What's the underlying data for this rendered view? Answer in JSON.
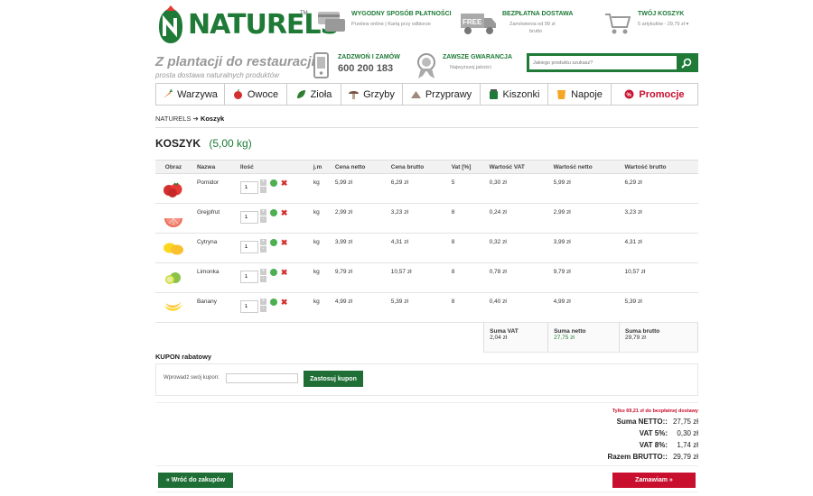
{
  "header": {
    "logo_text": "NATURELS",
    "logo_tm": "TM",
    "payment_title": "WYGODNY SPOSÓB PŁATNOŚCI",
    "payment_sub": "Przelew online | Kartą przy odbiorze",
    "free_badge": "FREE",
    "delivery_title": "BEZPŁATNA DOSTAWA",
    "delivery_sub1": "Zamówienia od 99 zł",
    "delivery_sub2": "brutto",
    "cart_title": "TWÓJ KOSZYK",
    "cart_sub": "5 artykułów - 29,79 zł ▾",
    "tagline": "Z plantacji do restauracji",
    "tagline_sub": "prosta dostawa naturalnych produktów",
    "phone_title": "ZADZWOŃ I ZAMÓW",
    "phone_number": "600 200 183",
    "guarantee_title": "ZAWSZE GWARANCJA",
    "guarantee_sub": "Najwyższej jakości",
    "search_placeholder": "Jakiego produktu szukasz?"
  },
  "nav": [
    {
      "label": "Warzywa",
      "icon": "carrot-icon",
      "color": "#e07b1f"
    },
    {
      "label": "Owoce",
      "icon": "apple-icon",
      "color": "#d32f2f"
    },
    {
      "label": "Zioła",
      "icon": "leaf-icon",
      "color": "#2e7d32"
    },
    {
      "label": "Grzyby",
      "icon": "mushroom-icon",
      "color": "#795548"
    },
    {
      "label": "Przyprawy",
      "icon": "spice-pile-icon",
      "color": "#a1887f"
    },
    {
      "label": "Kiszonki",
      "icon": "jar-icon",
      "color": "#1e7a36"
    },
    {
      "label": "Napoje",
      "icon": "drink-icon",
      "color": "#f5a623"
    },
    {
      "label": "Promocje",
      "icon": "promo-tag-icon",
      "color": "#c8102e"
    }
  ],
  "breadcrumb": {
    "home": "NATURELS",
    "sep": "➔",
    "current": "Koszyk"
  },
  "page": {
    "title": "KOSZYK",
    "weight": "(5,00 kg)"
  },
  "table": {
    "headers": [
      "Obraz",
      "Nazwa",
      "Ilość",
      "j.m",
      "Cena netto",
      "Cena brutto",
      "Vat [%]",
      "Wartość VAT",
      "Wartość netto",
      "Wartość brutto"
    ],
    "rows": [
      {
        "name": "Pomidor",
        "qty": "1",
        "unit": "kg",
        "net": "5,99 zł",
        "gross": "6,29 zł",
        "vat": "5",
        "vat_value": "0,30 zł",
        "net_value": "5,99 zł",
        "gross_value": "6,29 zł",
        "icon": "tomato-icon"
      },
      {
        "name": "Grejpfrut",
        "qty": "1",
        "unit": "kg",
        "net": "2,99 zł",
        "gross": "3,23 zł",
        "vat": "8",
        "vat_value": "0,24 zł",
        "net_value": "2,99 zł",
        "gross_value": "3,23 zł",
        "icon": "grapefruit-icon"
      },
      {
        "name": "Cytryna",
        "qty": "1",
        "unit": "kg",
        "net": "3,99 zł",
        "gross": "4,31 zł",
        "vat": "8",
        "vat_value": "0,32 zł",
        "net_value": "3,99 zł",
        "gross_value": "4,31 zł",
        "icon": "lemon-icon"
      },
      {
        "name": "Limonka",
        "qty": "1",
        "unit": "kg",
        "net": "9,79 zł",
        "gross": "10,57 zł",
        "vat": "8",
        "vat_value": "0,78 zł",
        "net_value": "9,79 zł",
        "gross_value": "10,57 zł",
        "icon": "lime-icon"
      },
      {
        "name": "Banany",
        "qty": "1",
        "unit": "kg",
        "net": "4,99 zł",
        "gross": "5,39 zł",
        "vat": "8",
        "vat_value": "0,40 zł",
        "net_value": "4,99 zł",
        "gross_value": "5,39 zł",
        "icon": "banana-icon"
      }
    ],
    "summary": {
      "vat_label": "Suma VAT",
      "vat_value": "2,04 zł",
      "net_label": "Suma netto",
      "net_value": "27,75 zł",
      "gross_label": "Suma brutto",
      "gross_value": "29,79 zł"
    }
  },
  "coupon": {
    "title": "KUPON rabatowy",
    "label": "Wprowadź swój kupon:",
    "value": "",
    "button": "Zastosuj kupon"
  },
  "totals": {
    "free_note": "Tylko 69,21 zł do bezpłatnej dostawy",
    "net_label": "Suma NETTO::",
    "net_value": "27,75 zł",
    "vat5_label": "VAT 5%:",
    "vat5_value": "0,30 zł",
    "vat8_label": "VAT 8%:",
    "vat8_value": "1,74 zł",
    "gross_label": "Razem BRUTTO::",
    "gross_value": "29,79 zł"
  },
  "buttons": {
    "back": "« Wróć do zakupów",
    "order": "Zamawiam »"
  },
  "colors": {
    "brand_green": "#1e7a36",
    "accent_red": "#c8102e"
  }
}
